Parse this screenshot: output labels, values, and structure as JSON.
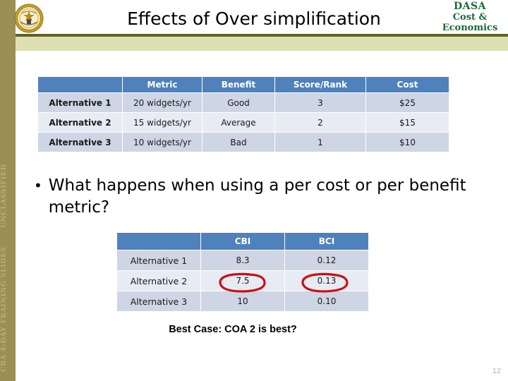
{
  "classification": {
    "top_label": "UNCLASSIFIED",
    "bottom_label": "CBA 4-DAY TRAINING SLIDES"
  },
  "header": {
    "title": "Effects of Over simplification",
    "seal_name": "department-of-the-army-seal",
    "logo": {
      "line1": "DASA",
      "line2": "Cost &",
      "line3": "Economics"
    }
  },
  "table1": {
    "headers": [
      "",
      "Metric",
      "Benefit",
      "Score/Rank",
      "Cost"
    ],
    "rows": [
      [
        "Alternative 1",
        "20 widgets/yr",
        "Good",
        "3",
        "$25"
      ],
      [
        "Alternative 2",
        "15 widgets/yr",
        "Average",
        "2",
        "$15"
      ],
      [
        "Alternative 3",
        "10 widgets/yr",
        "Bad",
        "1",
        "$10"
      ]
    ]
  },
  "bullet": {
    "marker": "•",
    "text": "What happens when using a per cost or per benefit metric?"
  },
  "table2": {
    "headers": [
      "",
      "CBI",
      "BCI"
    ],
    "rows": [
      [
        "Alternative 1",
        "8.3",
        "0.12"
      ],
      [
        "Alternative 2",
        "7.5",
        "0.13"
      ],
      [
        "Alternative 3",
        "10",
        "0.10"
      ]
    ],
    "annotations": [
      {
        "name": "red-ellipse-cbi-alt2",
        "target": "7.5"
      },
      {
        "name": "red-ellipse-bci-alt2",
        "target": "0.13"
      }
    ]
  },
  "caption": "Best Case:  COA 2 is best?",
  "page_number": "12",
  "colors": {
    "sidebar_bg": "#9a9055",
    "sidebar_text": "#b8ae77",
    "header_rule": "#5e6325",
    "header_band": "#dfdfb4",
    "table_header_blue": "#4f81bd",
    "table_band_a": "#ced5e4",
    "table_band_b": "#e7ebf3",
    "annotation_red": "#cc1111",
    "logo_green": "#1d6b35",
    "page_number_gray": "#b6b6b6"
  }
}
